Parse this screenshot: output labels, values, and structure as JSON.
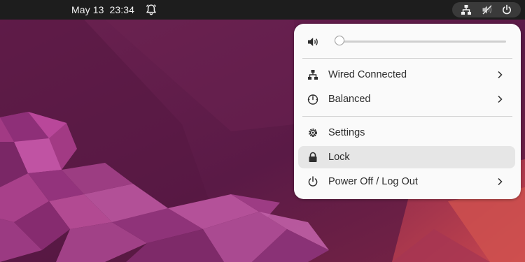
{
  "top_bar": {
    "date": "May 13",
    "time": "23:34",
    "icons": [
      "bell-icon",
      "network-icon",
      "volume-muted-icon",
      "power-icon"
    ]
  },
  "quick_menu": {
    "volume": {
      "level": 0,
      "icon": "volume-icon"
    },
    "items": [
      {
        "label": "Wired Connected",
        "icon": "network-icon",
        "has_submenu": true
      },
      {
        "label": "Balanced",
        "icon": "power-profile-icon",
        "has_submenu": true
      },
      {
        "label": "Settings",
        "icon": "gear-icon",
        "has_submenu": false
      },
      {
        "label": "Lock",
        "icon": "lock-icon",
        "has_submenu": false,
        "highlighted": true
      },
      {
        "label": "Power Off / Log Out",
        "icon": "power-icon",
        "has_submenu": true
      }
    ]
  },
  "colors": {
    "topbar": "#1d1d1d",
    "menu_bg": "#fafafa",
    "highlight": "#e6e6e6",
    "wallpaper_dark": "#5b1a44",
    "wallpaper_accent": "#b23a5a"
  }
}
